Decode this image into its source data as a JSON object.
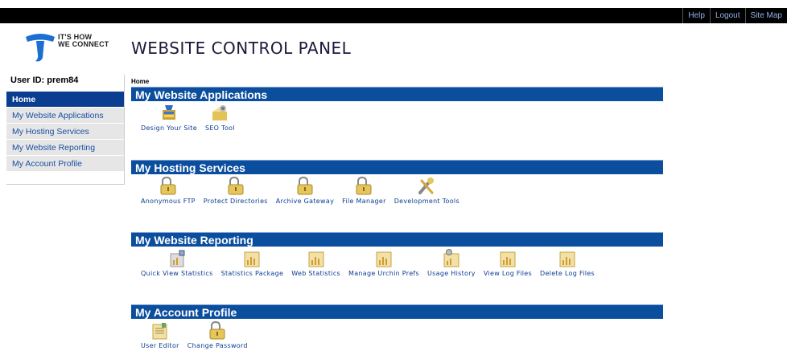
{
  "topnav": {
    "links": [
      "Help",
      "Logout",
      "Site Map"
    ]
  },
  "logo": {
    "line1": "IT'S HOW",
    "line2": "WE CONNECT"
  },
  "header": {
    "title": "WEBSITE CONTROL PANEL"
  },
  "sidebar": {
    "user_id": "User ID: prem84",
    "items": [
      {
        "label": "Home",
        "active": true
      },
      {
        "label": "My Website Applications"
      },
      {
        "label": "My Hosting Services"
      },
      {
        "label": "My Website Reporting"
      },
      {
        "label": "My Account Profile"
      }
    ]
  },
  "breadcrumb": "Home",
  "sections": [
    {
      "title": "My Website Applications",
      "apps": [
        {
          "label": "Design Your Site",
          "icon": "design-icon"
        },
        {
          "label": "SEO Tool",
          "icon": "seo-icon"
        }
      ]
    },
    {
      "title": "My Hosting Services",
      "apps": [
        {
          "label": "Anonymous FTP",
          "icon": "lock-icon"
        },
        {
          "label": "Protect Directories",
          "icon": "lock-icon"
        },
        {
          "label": "Archive Gateway",
          "icon": "lock-icon"
        },
        {
          "label": "File Manager",
          "icon": "lock-icon"
        },
        {
          "label": "Development Tools",
          "icon": "tools-icon"
        }
      ]
    },
    {
      "title": "My Website Reporting",
      "apps": [
        {
          "label": "Quick View Statistics",
          "icon": "quick-stats-icon"
        },
        {
          "label": "Statistics Package",
          "icon": "chart-icon"
        },
        {
          "label": "Web Statistics",
          "icon": "chart-icon"
        },
        {
          "label": "Manage Urchin Prefs",
          "icon": "chart-icon"
        },
        {
          "label": "Usage History",
          "icon": "chart-gear-icon"
        },
        {
          "label": "View Log Files",
          "icon": "chart-icon"
        },
        {
          "label": "Delete Log Files",
          "icon": "chart-icon"
        }
      ]
    },
    {
      "title": "My Account Profile",
      "apps": [
        {
          "label": "User Editor",
          "icon": "user-editor-icon"
        },
        {
          "label": "Change Password",
          "icon": "lock-icon"
        }
      ]
    }
  ]
}
